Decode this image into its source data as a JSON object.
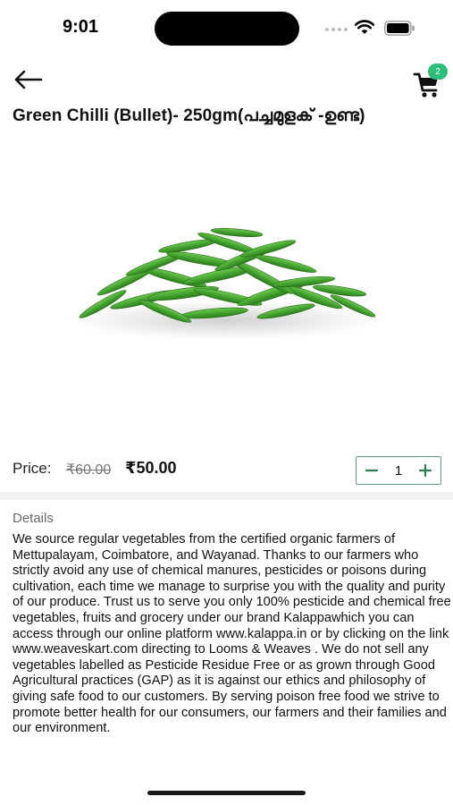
{
  "status_bar": {
    "time": "9:01"
  },
  "header": {
    "cart_count": "2"
  },
  "product": {
    "title": "Green Chilli (Bullet)- 250gm(പച്ചമുളക് -ഉണ്ട)",
    "price_label": "Price:",
    "old_price": "₹60.00",
    "new_price": "₹50.00",
    "quantity": "1"
  },
  "details": {
    "heading": "Details",
    "body": "We source regular vegetables from the certified organic farmers of Mettupalayam, Coimbatore, and Wayanad. Thanks to our farmers who strictly avoid any use of chemical manures, pesticides or poisons during cultivation, each time we manage to surprise you with the quality and purity of our produce. Trust us to serve you only 100% pesticide and chemical free vegetables, fruits and grocery under our brand Kalappawhich you can access through our online platform www.kalappa.in or by clicking on the link www.weaveskart.com directing to Looms & Weaves . We do not sell any vegetables labelled as Pesticide Residue Free or as grown through Good Agricultural practices (GAP) as it is against our ethics and philosophy of giving safe food to our customers. By serving poison free food we strive to promote better health for our consumers, our farmers and their families and our environment."
  },
  "colors": {
    "accent": "#2bbf7a",
    "qty_border": "#5a9e78",
    "chilli": "#4caf3a"
  }
}
